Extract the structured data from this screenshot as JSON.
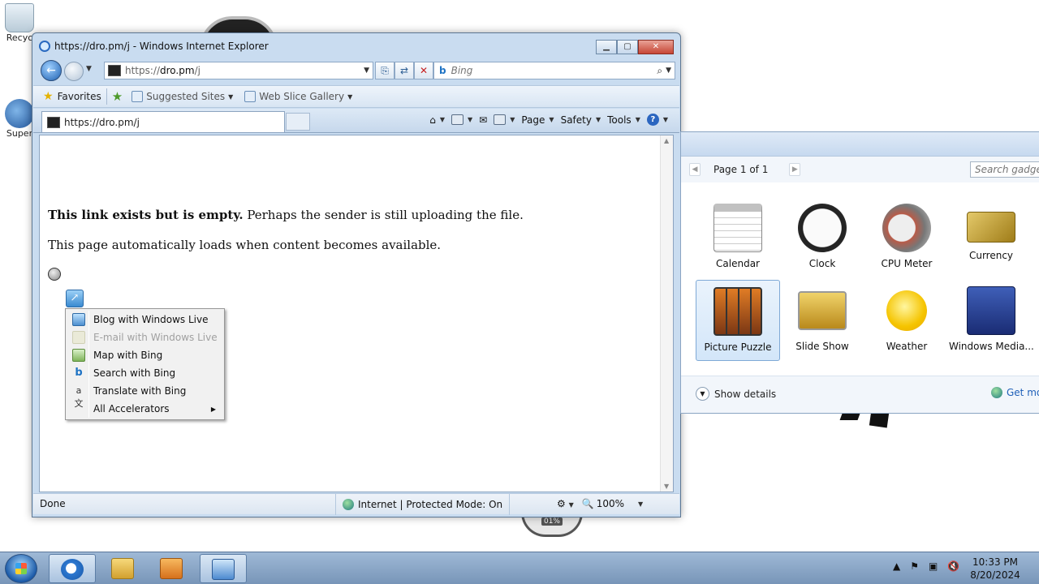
{
  "desktop": {
    "icons": [
      {
        "label": "Recyc"
      },
      {
        "label": "Super"
      }
    ],
    "gauge_text": "01%"
  },
  "ie": {
    "window_title": "https://dro.pm/j - Windows Internet Explorer",
    "address_prefix": "https://",
    "address_domain": "dro.pm",
    "address_path": "/j",
    "search_placeholder": "Bing",
    "favorites_label": "Favorites",
    "suggested_sites": "Suggested Sites",
    "web_slice_gallery": "Web Slice Gallery",
    "tab_title": "https://dro.pm/j",
    "commands": {
      "page": "Page",
      "safety": "Safety",
      "tools": "Tools"
    },
    "content": {
      "bold_text": "This link exists but is empty.",
      "rest_text": " Perhaps the sender is still uploading the file.",
      "auto_load_text": "This page automatically loads when content becomes available."
    },
    "accelerator_menu": {
      "items": [
        {
          "label": "Blog with Windows Live",
          "enabled": true
        },
        {
          "label": "E-mail with Windows Live",
          "enabled": false
        },
        {
          "label": "Map with Bing",
          "enabled": true
        },
        {
          "label": "Search with Bing",
          "enabled": true
        },
        {
          "label": "Translate with Bing",
          "enabled": true
        },
        {
          "label": "All Accelerators",
          "enabled": true
        }
      ]
    },
    "status": {
      "text": "Done",
      "zone": "Internet | Protected Mode: On",
      "zoom": "100%"
    }
  },
  "gadget_gallery": {
    "page_label": "Page 1 of 1",
    "search_placeholder": "Search gadgets",
    "gadgets": [
      {
        "label": "Calendar",
        "selected": false
      },
      {
        "label": "Clock",
        "selected": false
      },
      {
        "label": "CPU Meter",
        "selected": false
      },
      {
        "label": "Currency",
        "selected": false
      },
      {
        "label": "Picture Puzzle",
        "selected": true
      },
      {
        "label": "Slide Show",
        "selected": false
      },
      {
        "label": "Weather",
        "selected": false
      },
      {
        "label": "Windows Media...",
        "selected": false
      }
    ],
    "show_details": "Show details",
    "get_more": "Get mo"
  },
  "taskbar": {
    "clock_time": "10:33 PM",
    "clock_date": "8/20/2024"
  }
}
